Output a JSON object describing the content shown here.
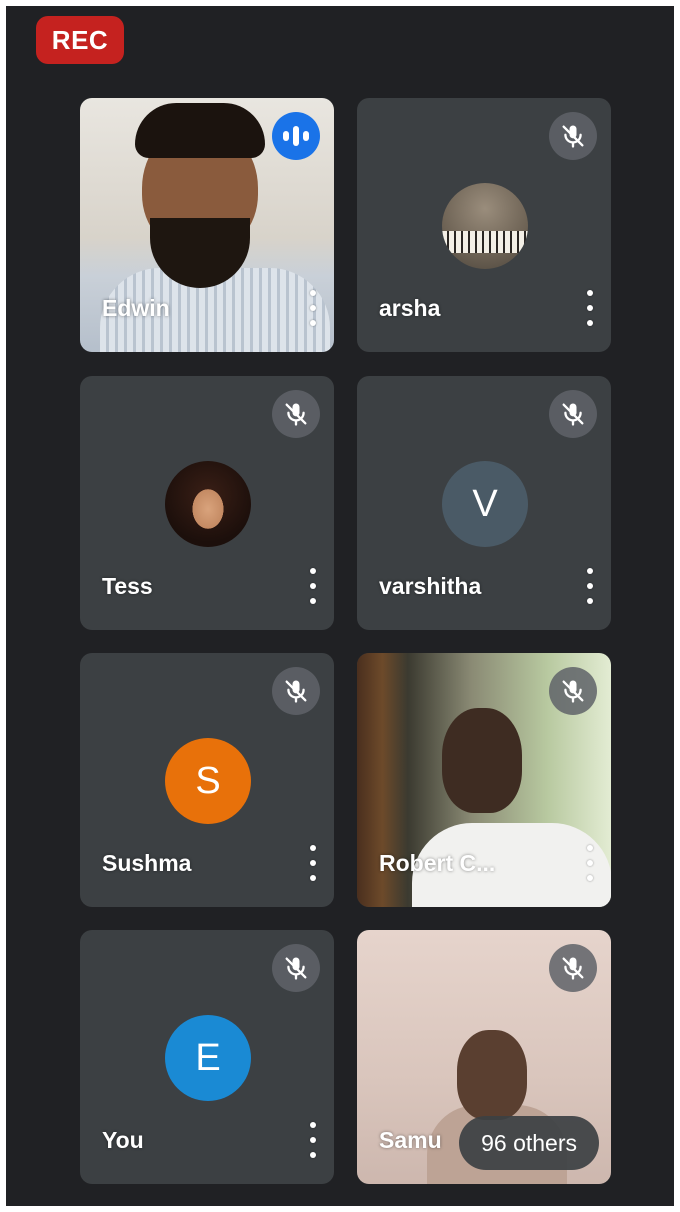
{
  "recording": {
    "label": "REC",
    "color": "#c5221f"
  },
  "colors": {
    "background": "#202124",
    "tile": "#3c4043",
    "speaking_indicator": "#1a73e8",
    "mic_off_badge": "#5f6368"
  },
  "participants": [
    {
      "name": "Edwin",
      "media": "video",
      "mic": "speaking",
      "icon": "speaking-indicator-icon",
      "more_icon": "more-vert-icon"
    },
    {
      "name": "arsha",
      "media": "profile-photo",
      "mic": "muted",
      "icon": "mic-off-icon",
      "more_icon": "more-vert-icon"
    },
    {
      "name": "Tess",
      "media": "profile-photo",
      "mic": "muted",
      "icon": "mic-off-icon",
      "more_icon": "more-vert-icon"
    },
    {
      "name": "varshitha",
      "media": "initial",
      "initial": "V",
      "avatar_color": "#4a5a66",
      "mic": "muted",
      "icon": "mic-off-icon",
      "more_icon": "more-vert-icon"
    },
    {
      "name": "Sushma",
      "media": "initial",
      "initial": "S",
      "avatar_color": "#e8710a",
      "mic": "muted",
      "icon": "mic-off-icon",
      "more_icon": "more-vert-icon"
    },
    {
      "name": "Robert C...",
      "media": "video",
      "mic": "muted",
      "icon": "mic-off-icon",
      "more_icon": "more-vert-icon"
    },
    {
      "name": "You",
      "media": "initial",
      "initial": "E",
      "avatar_color": "#1a8ad4",
      "mic": "muted",
      "icon": "mic-off-icon",
      "more_icon": "more-vert-icon"
    },
    {
      "name": "Samu",
      "media": "video",
      "mic": "muted",
      "icon": "mic-off-icon"
    }
  ],
  "overflow": {
    "label": "96 others"
  }
}
